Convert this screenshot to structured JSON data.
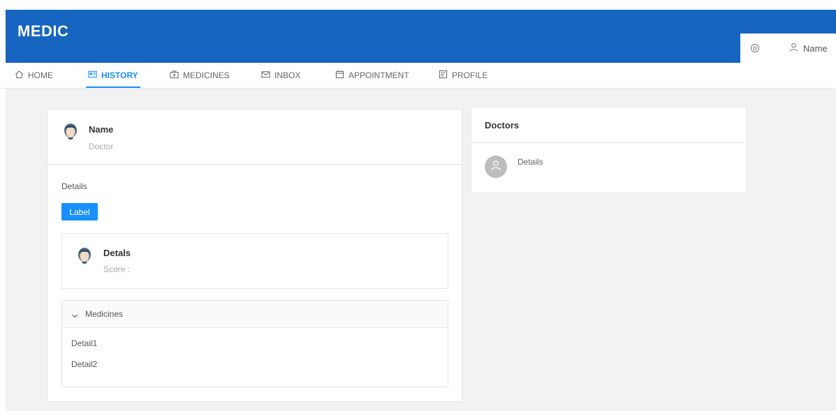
{
  "app": {
    "title": "MEDIC"
  },
  "header": {
    "user_name": "Name",
    "settings_icon": "gear-icon",
    "user_icon": "user-icon"
  },
  "nav": {
    "tabs": [
      {
        "label": "HOME",
        "icon": "home-icon",
        "active": false
      },
      {
        "label": "HISTORY",
        "icon": "id-card-icon",
        "active": true
      },
      {
        "label": "MEDICINES",
        "icon": "medicine-box-icon",
        "active": false
      },
      {
        "label": "INBOX",
        "icon": "mail-icon",
        "active": false
      },
      {
        "label": "APPOINTMENT",
        "icon": "calendar-icon",
        "active": false
      },
      {
        "label": "PROFILE",
        "icon": "profile-icon",
        "active": false
      }
    ]
  },
  "history_card": {
    "meta": {
      "title": "Name",
      "description": "Doctor"
    },
    "details_label": "Details",
    "label_button": "Label",
    "inner": {
      "title": "Detals",
      "description": "Score :"
    },
    "medicines": {
      "header": "Medicines",
      "items": [
        "Detail1",
        "Detail2"
      ]
    }
  },
  "doctors_card": {
    "title": "Doctors",
    "item": {
      "details": "Details"
    }
  },
  "colors": {
    "header_bg": "#1565c0",
    "accent": "#1890ff",
    "content_bg": "#f2f2f2"
  }
}
